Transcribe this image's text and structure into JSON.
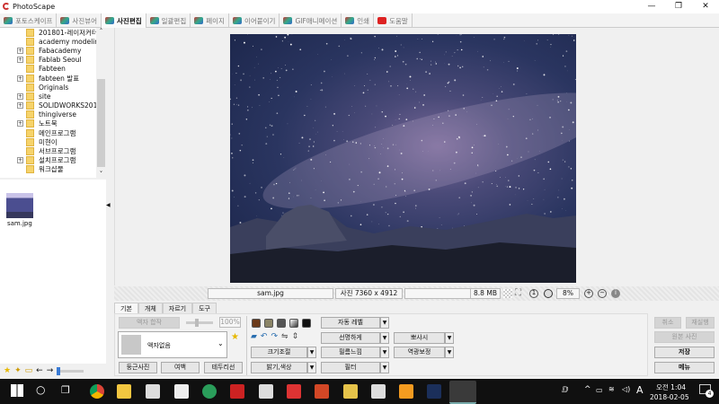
{
  "app": {
    "title": "PhotoScape"
  },
  "tabs": [
    {
      "label": "포토스케이프"
    },
    {
      "label": "사진뷰어"
    },
    {
      "label": "사진편집",
      "active": true
    },
    {
      "label": "일괄편집"
    },
    {
      "label": "페이지"
    },
    {
      "label": "이어붙이기"
    },
    {
      "label": "GIF애니메이션"
    },
    {
      "label": "인쇄"
    },
    {
      "label": "도움말"
    }
  ],
  "tree": {
    "items": [
      {
        "label": "201801-레이저커터_",
        "expand": false
      },
      {
        "label": "academy modeling",
        "expand": false
      },
      {
        "label": "Fabacademy",
        "expand": true
      },
      {
        "label": "Fablab Seoul",
        "expand": true
      },
      {
        "label": "Fabteen",
        "expand": false
      },
      {
        "label": "fabteen 발표",
        "expand": true
      },
      {
        "label": "Originals",
        "expand": false
      },
      {
        "label": "site",
        "expand": true
      },
      {
        "label": "SOLIDWORKS2012",
        "expand": true
      },
      {
        "label": "thingiverse",
        "expand": false
      },
      {
        "label": "노트북",
        "expand": true
      },
      {
        "label": "메인프로그램",
        "expand": false
      },
      {
        "label": "미현이",
        "expand": false
      },
      {
        "label": "서브프로그램",
        "expand": false
      },
      {
        "label": "설치프로그램",
        "expand": true
      },
      {
        "label": "워크샵물",
        "expand": false
      }
    ]
  },
  "thumbnails": [
    {
      "label": "sam.jpg"
    }
  ],
  "status": {
    "filename": "sam.jpg",
    "dimensions": "사진 7360 x 4912",
    "filesize": "8.8 MB",
    "zoom": "8%"
  },
  "edit": {
    "tabs": [
      "기본",
      "개체",
      "자르기",
      "도구"
    ],
    "frame_merge": "액자 합작",
    "opacity": "100%",
    "frame_select": "액자없음",
    "round": "둥근사진",
    "margin": "여백",
    "border": "테두리선",
    "resize": "크기조절",
    "brightness": "밝기,색상",
    "auto_level": "자동 레벨",
    "sharpen": "선명하게",
    "film": "필름느낌",
    "filter": "필터",
    "soft": "뽀샤시",
    "backlight": "역광보정",
    "undo": "취소",
    "redo": "재실행",
    "original": "원본 사진",
    "save": "저장",
    "menu": "메뉴"
  },
  "tray": {
    "ime": "A",
    "time": "오전 1:04",
    "date": "2018-02-05",
    "notifications": "4"
  }
}
